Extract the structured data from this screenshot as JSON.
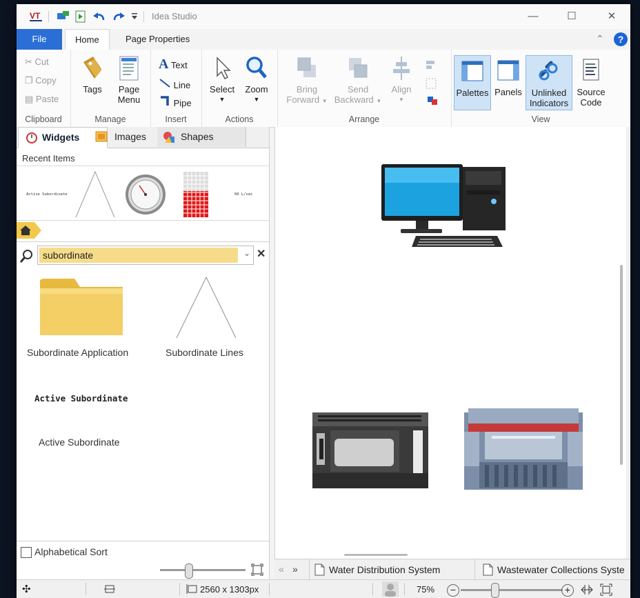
{
  "window": {
    "title": "Idea Studio"
  },
  "ribbon_tabs": {
    "file": "File",
    "home": "Home",
    "page_properties": "Page Properties"
  },
  "clipboard": {
    "cut": "Cut",
    "copy": "Copy",
    "paste": "Paste",
    "label": "Clipboard"
  },
  "manage": {
    "tags": "Tags",
    "page_menu_1": "Page",
    "page_menu_2": "Menu",
    "label": "Manage"
  },
  "insert": {
    "text": "Text",
    "line": "Line",
    "pipe": "Pipe",
    "label": "Insert"
  },
  "actions": {
    "select": "Select",
    "zoom": "Zoom",
    "label": "Actions"
  },
  "arrange": {
    "bring_1": "Bring",
    "bring_2": "Forward",
    "send_1": "Send",
    "send_2": "Backward",
    "align": "Align",
    "label": "Arrange"
  },
  "view": {
    "palettes": "Palettes",
    "panels": "Panels",
    "unlinked_1": "Unlinked",
    "unlinked_2": "Indicators",
    "source_1": "Source",
    "source_2": "Code",
    "label": "View"
  },
  "left_tabs": {
    "widgets": "Widgets",
    "images": "Images",
    "shapes": "Shapes"
  },
  "recent": {
    "label": "Recent Items",
    "item1": "Active Subordinate",
    "item5": "60 L/sec"
  },
  "search": {
    "value": "subordinate"
  },
  "results": {
    "app": "Subordinate Application",
    "lines": "Subordinate Lines",
    "active_mono": "Active Subordinate",
    "active_plain": "Active Subordinate"
  },
  "alpha_sort": "Alphabetical Sort",
  "page_tabs": {
    "tab1": "Water Distribution System",
    "tab2": "Wastewater Collections Syste"
  },
  "status": {
    "size": "2560 x 1303px",
    "zoom": "75%"
  },
  "colors": {
    "accent": "#2b6fd6",
    "search_highlight": "#f6dc8a",
    "selected_view": "#cfe3f7"
  }
}
